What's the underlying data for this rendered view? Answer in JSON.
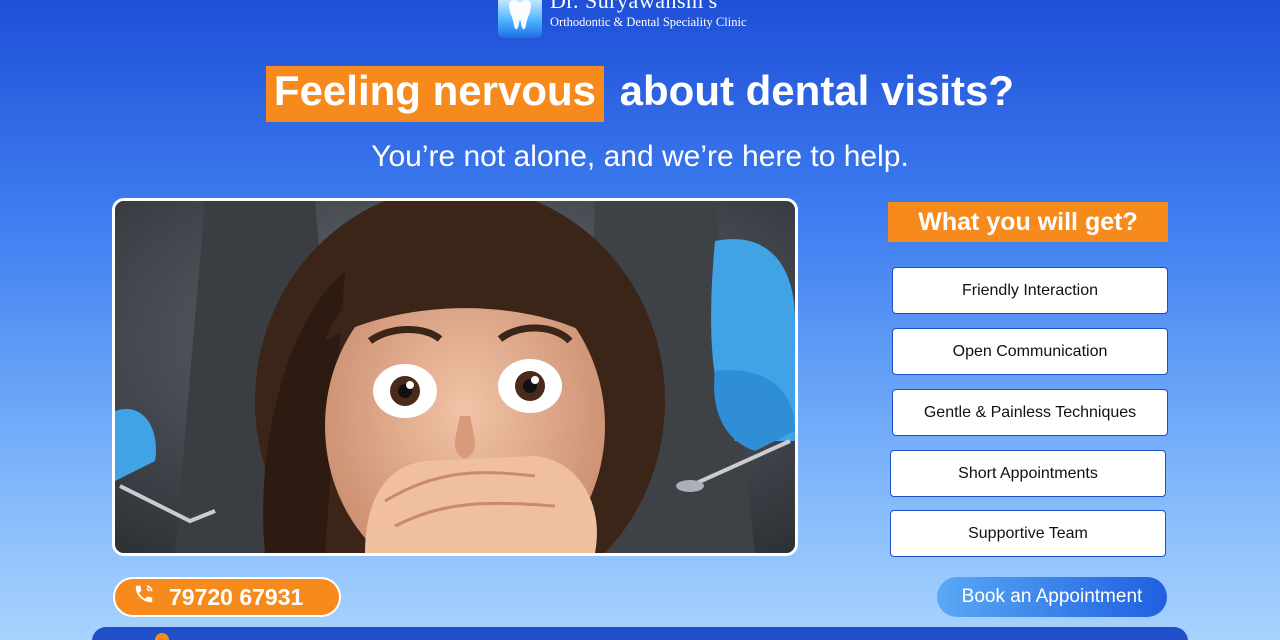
{
  "clinic": {
    "name": "Dr. Suryawanshi's",
    "subtitle": "Orthodontic & Dental Speciality Clinic",
    "logo_icon": "tooth-logo-icon"
  },
  "headline": {
    "highlight": "Feeling nervous",
    "rest": "about dental visits?"
  },
  "subheadline": "You’re not alone, and we’re here to help.",
  "photo": {
    "description_icon": "nervous-child-dental-photo"
  },
  "benefits": {
    "title": "What you will get?",
    "items": [
      "Friendly Interaction",
      "Open Communication",
      "Gentle & Painless Techniques",
      "Short Appointments",
      "Supportive Team"
    ]
  },
  "contact": {
    "phone": "79720 67931",
    "phone_icon": "phone-icon"
  },
  "cta": {
    "book_label": "Book an Appointment"
  },
  "colors": {
    "accent_orange": "#f78a1d",
    "brand_blue": "#1f4fd8",
    "light_blue": "#a9d3fe"
  }
}
